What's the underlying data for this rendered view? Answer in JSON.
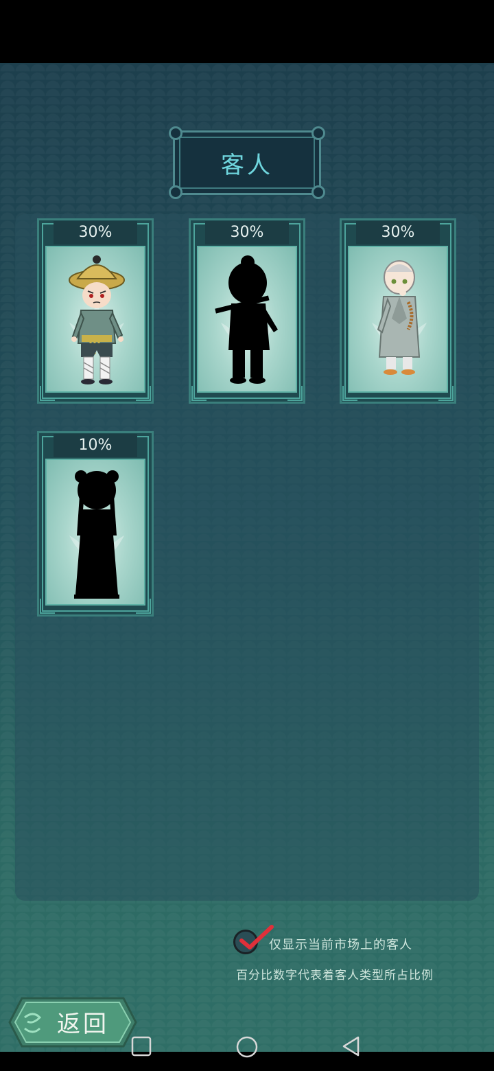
{
  "title": "客人",
  "customers": [
    {
      "percent": "30%",
      "figure": "farmer-with-straw-hat",
      "revealed": true
    },
    {
      "percent": "30%",
      "figure": "silhouette-with-sword",
      "revealed": false
    },
    {
      "percent": "30%",
      "figure": "monk-with-prayer-beads",
      "revealed": true
    },
    {
      "percent": "10%",
      "figure": "silhouette-lady",
      "revealed": false
    }
  ],
  "filter": {
    "label": "仅显示当前市场上的客人",
    "checked": true
  },
  "note": "百分比数字代表着客人类型所占比例",
  "back_button": {
    "label": "返回"
  },
  "colors": {
    "accent": "#6fd6de",
    "card_border": "#4da49c",
    "check": "#e0303a"
  },
  "nav": {
    "icons": [
      "recent-apps-icon",
      "home-icon",
      "back-icon"
    ]
  }
}
